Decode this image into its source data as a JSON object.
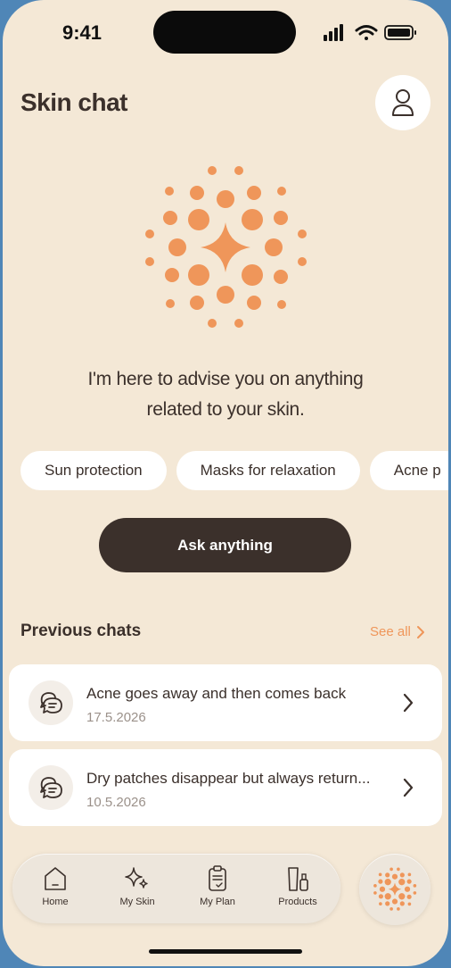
{
  "status_bar": {
    "time": "9:41"
  },
  "header": {
    "title": "Skin chat"
  },
  "intro": {
    "line1": "I'm here to advise you on anything",
    "line2": "related to your skin."
  },
  "chips": [
    {
      "label": "Sun protection"
    },
    {
      "label": "Masks for relaxation"
    },
    {
      "label": "Acne p"
    }
  ],
  "ask_button": {
    "label": "Ask anything"
  },
  "previous_chats": {
    "heading": "Previous chats",
    "see_all": "See all",
    "items": [
      {
        "title": "Acne goes away and then comes back",
        "date": "17.5.2026"
      },
      {
        "title": "Dry patches disappear but always return...",
        "date": "10.5.2026"
      }
    ]
  },
  "tab_bar": {
    "items": [
      {
        "label": "Home",
        "icon": "home-icon"
      },
      {
        "label": "My Skin",
        "icon": "sparkles-icon"
      },
      {
        "label": "My Plan",
        "icon": "clipboard-icon"
      },
      {
        "label": "Products",
        "icon": "products-icon"
      }
    ],
    "assistant_icon": "ai-orb-icon"
  },
  "colors": {
    "background": "#f4e8d6",
    "accent": "#ef965a",
    "dark": "#3b302b",
    "card": "#ffffff"
  }
}
